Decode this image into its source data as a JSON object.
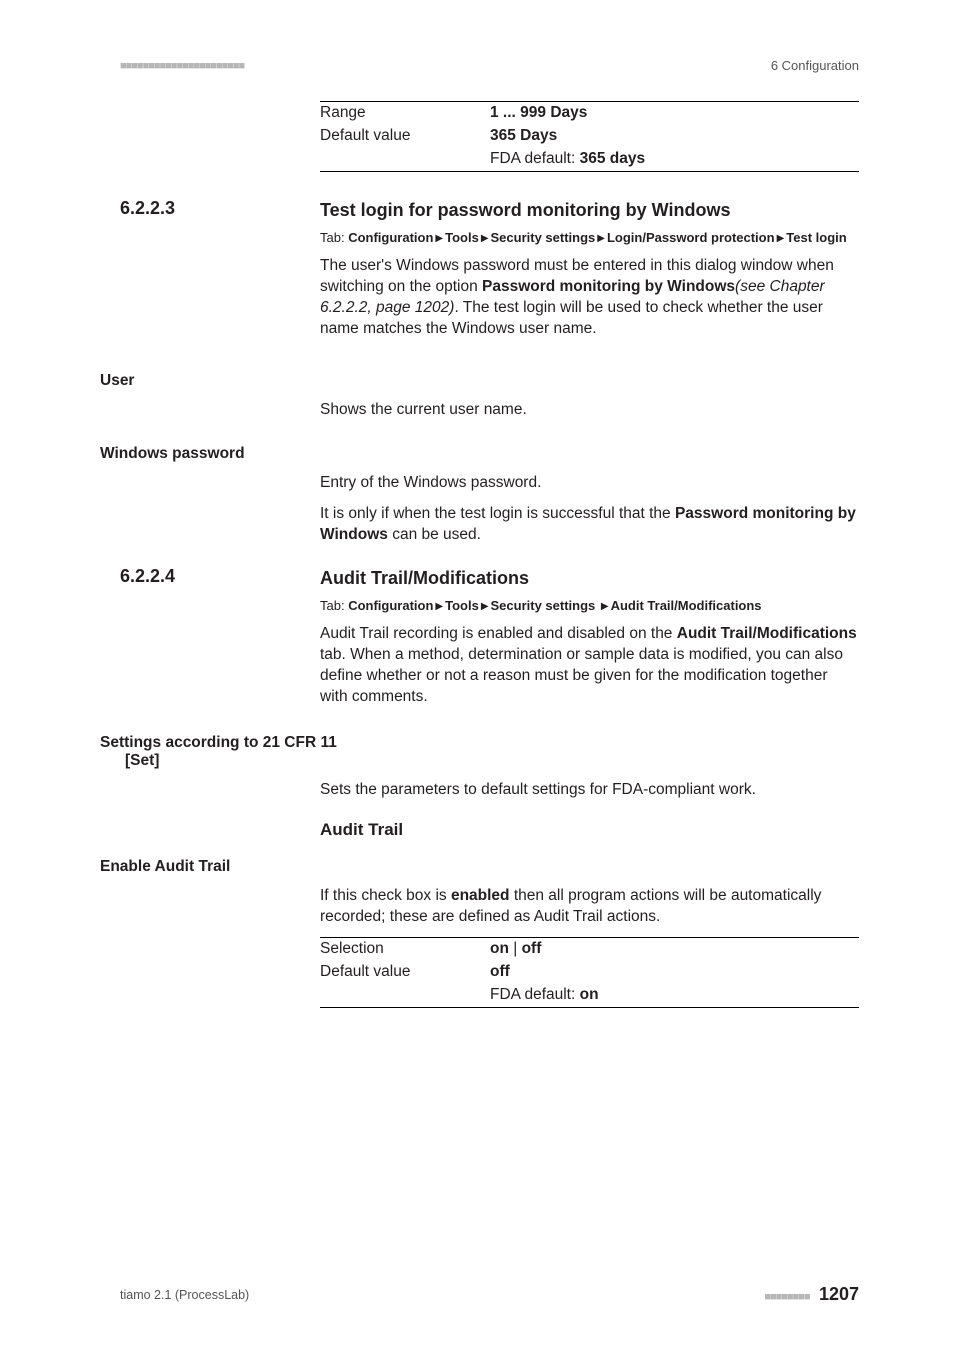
{
  "header": {
    "dots": "■■■■■■■■■■■■■■■■■■■■■■",
    "breadcrumb": "6 Configuration"
  },
  "intro_table": {
    "rows": [
      {
        "k": "Range",
        "v_strong": "1 ... 999 Days",
        "v_plain": ""
      },
      {
        "k": "Default value",
        "v_strong": "365 Days",
        "v_plain": ""
      },
      {
        "k": "",
        "v_strong": "365 days",
        "v_plain": "FDA default: "
      }
    ]
  },
  "s6223": {
    "num": "6.2.2.3",
    "title": "Test login for password monitoring by Windows",
    "tab_label": "Tab: ",
    "tab_parts": [
      "Configuration",
      "Tools",
      "Security settings",
      "Login/Password protection",
      "Test login"
    ],
    "p1_a": "The user's Windows password must be entered in this dialog window when switching on the option ",
    "p1_b_strong": "Password monitoring by Windows",
    "p1_c_italic": "(see Chapter 6.2.2.2, page 1202)",
    "p1_d": ". The test login will be used to check whether the user name matches the Windows user name.",
    "user_heading": "User",
    "user_body": "Shows the current user name.",
    "wpw_heading": "Windows password",
    "wpw_body1": "Entry of the Windows password.",
    "wpw_body2_a": "It is only if when the test login is successful that the ",
    "wpw_body2_b_strong": "Password monitoring by Windows",
    "wpw_body2_c": " can be used."
  },
  "s6224": {
    "num": "6.2.2.4",
    "title": "Audit Trail/Modifications",
    "tab_label": "Tab: ",
    "tab_parts": [
      "Configuration",
      "Tools",
      "Security settings ",
      "Audit Trail/Modifications"
    ],
    "p1_a": "Audit Trail recording is enabled and disabled on the ",
    "p1_b_strong": "Audit Trail/Modifications",
    "p1_c": " tab. When a method, determination or sample data is modified, you can also define whether or not a reason must be given for the modification together with comments.",
    "settings_heading": "Settings according to 21 CFR 11",
    "set_label": "[Set]",
    "set_body": "Sets the parameters to default settings for FDA-compliant work.",
    "audit_heading": "Audit Trail",
    "enable_heading": "Enable Audit Trail",
    "enable_body_a": "If this check box is ",
    "enable_body_b_strong": "enabled",
    "enable_body_c": " then all program actions will be automatically recorded; these are defined as Audit Trail actions.",
    "enable_table": {
      "rows": [
        {
          "k": "Selection",
          "parts": [
            {
              "t": "on",
              "b": true
            },
            {
              "t": " | ",
              "b": false
            },
            {
              "t": "off",
              "b": true
            }
          ]
        },
        {
          "k": "Default value",
          "parts": [
            {
              "t": "off",
              "b": true
            }
          ]
        },
        {
          "k": "",
          "parts": [
            {
              "t": "FDA default: ",
              "b": false
            },
            {
              "t": "on",
              "b": true
            }
          ]
        }
      ]
    }
  },
  "footer": {
    "left": "tiamo 2.1 (ProcessLab)",
    "dots": "■■■■■■■■",
    "page": "1207"
  }
}
